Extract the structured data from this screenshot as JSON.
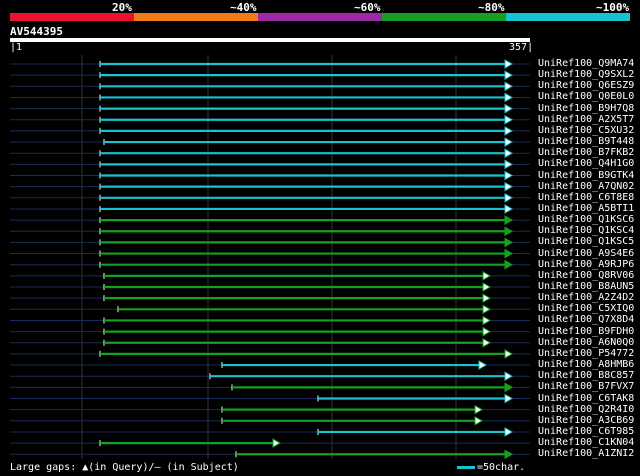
{
  "legend": {
    "labels": [
      "20%",
      "~40%",
      "~60%",
      "~80%",
      "~100%"
    ],
    "colors": [
      "#e8112e",
      "#f07a19",
      "#9c27a8",
      "#16a021",
      "#19c2cf"
    ]
  },
  "query": {
    "name": "AV544395",
    "start": "1",
    "end": "357"
  },
  "hits": [
    {
      "name": "UniRef100_Q9MA74",
      "start": 100,
      "end": 512,
      "color": "cyan",
      "arrow": "open"
    },
    {
      "name": "UniRef100_Q9SXL2",
      "start": 100,
      "end": 512,
      "color": "cyan",
      "arrow": "open"
    },
    {
      "name": "UniRef100_Q6ESZ9",
      "start": 100,
      "end": 512,
      "color": "cyan",
      "arrow": "open"
    },
    {
      "name": "UniRef100_Q0E0L0",
      "start": 100,
      "end": 512,
      "color": "cyan",
      "arrow": "open"
    },
    {
      "name": "UniRef100_B9H7Q8",
      "start": 100,
      "end": 512,
      "color": "cyan",
      "arrow": "open"
    },
    {
      "name": "UniRef100_A2X5T7",
      "start": 100,
      "end": 512,
      "color": "cyan",
      "arrow": "open"
    },
    {
      "name": "UniRef100_C5XU32",
      "start": 100,
      "end": 512,
      "color": "cyan",
      "arrow": "open"
    },
    {
      "name": "UniRef100_B9T448",
      "start": 104,
      "end": 512,
      "color": "cyan",
      "arrow": "open"
    },
    {
      "name": "UniRef100_B7FKB2",
      "start": 100,
      "end": 512,
      "color": "cyan",
      "arrow": "open"
    },
    {
      "name": "UniRef100_Q4H1G0",
      "start": 100,
      "end": 512,
      "color": "cyan",
      "arrow": "open"
    },
    {
      "name": "UniRef100_B9GTK4",
      "start": 100,
      "end": 512,
      "color": "cyan",
      "arrow": "open"
    },
    {
      "name": "UniRef100_A7QN02",
      "start": 100,
      "end": 512,
      "color": "cyan",
      "arrow": "open"
    },
    {
      "name": "UniRef100_C6T8E8",
      "start": 100,
      "end": 512,
      "color": "cyan",
      "arrow": "open"
    },
    {
      "name": "UniRef100_A5BTI1",
      "start": 100,
      "end": 512,
      "color": "cyan",
      "arrow": "open"
    },
    {
      "name": "UniRef100_Q1KSC6",
      "start": 100,
      "end": 512,
      "color": "green",
      "arrow": "solid"
    },
    {
      "name": "UniRef100_Q1KSC4",
      "start": 100,
      "end": 512,
      "color": "green",
      "arrow": "solid"
    },
    {
      "name": "UniRef100_Q1KSC5",
      "start": 100,
      "end": 512,
      "color": "green",
      "arrow": "solid"
    },
    {
      "name": "UniRef100_A9S4E6",
      "start": 100,
      "end": 512,
      "color": "green",
      "arrow": "solid"
    },
    {
      "name": "UniRef100_A9RJP6",
      "start": 100,
      "end": 512,
      "color": "green",
      "arrow": "solid"
    },
    {
      "name": "UniRef100_Q8RV06",
      "start": 104,
      "end": 490,
      "color": "green",
      "arrow": "open"
    },
    {
      "name": "UniRef100_B8AUN5",
      "start": 104,
      "end": 490,
      "color": "green",
      "arrow": "open"
    },
    {
      "name": "UniRef100_A2Z4D2",
      "start": 104,
      "end": 490,
      "color": "green",
      "arrow": "open"
    },
    {
      "name": "UniRef100_C5XIQ0",
      "start": 118,
      "end": 490,
      "color": "green",
      "arrow": "open"
    },
    {
      "name": "UniRef100_Q7X8D4",
      "start": 104,
      "end": 490,
      "color": "green",
      "arrow": "open"
    },
    {
      "name": "UniRef100_B9FDH0",
      "start": 104,
      "end": 490,
      "color": "green",
      "arrow": "open"
    },
    {
      "name": "UniRef100_A6N0Q0",
      "start": 104,
      "end": 490,
      "color": "green",
      "arrow": "open"
    },
    {
      "name": "UniRef100_P54772",
      "start": 100,
      "end": 512,
      "color": "green",
      "arrow": "open"
    },
    {
      "name": "UniRef100_A8HMB6",
      "start": 222,
      "end": 486,
      "color": "cyan",
      "arrow": "open"
    },
    {
      "name": "UniRef100_B8C857",
      "start": 210,
      "end": 512,
      "color": "cyan",
      "arrow": "open"
    },
    {
      "name": "UniRef100_B7FVX7",
      "start": 232,
      "end": 512,
      "color": "green",
      "arrow": "solid"
    },
    {
      "name": "UniRef100_C6TAK8",
      "start": 318,
      "end": 512,
      "color": "cyan",
      "arrow": "open"
    },
    {
      "name": "UniRef100_Q2R4I0",
      "start": 222,
      "end": 482,
      "color": "green",
      "arrow": "open"
    },
    {
      "name": "UniRef100_A3CB69",
      "start": 222,
      "end": 482,
      "color": "green",
      "arrow": "open"
    },
    {
      "name": "UniRef100_C6T985",
      "start": 318,
      "end": 512,
      "color": "cyan",
      "arrow": "open"
    },
    {
      "name": "UniRef100_C1KN04",
      "start": 100,
      "end": 280,
      "color": "green",
      "arrow": "open"
    },
    {
      "name": "UniRef100_A1ZNI2",
      "start": 236,
      "end": 512,
      "color": "green",
      "arrow": "solid"
    }
  ],
  "footer": {
    "text": "Large gaps: ▲(in Query)/– (in Subject)"
  },
  "scale": {
    "text": "=50char."
  },
  "colors": {
    "cyan": "#19c2cf",
    "green": "#16a021",
    "background": "#000000",
    "grid": "#333333",
    "baseline": "#1c2a55"
  }
}
